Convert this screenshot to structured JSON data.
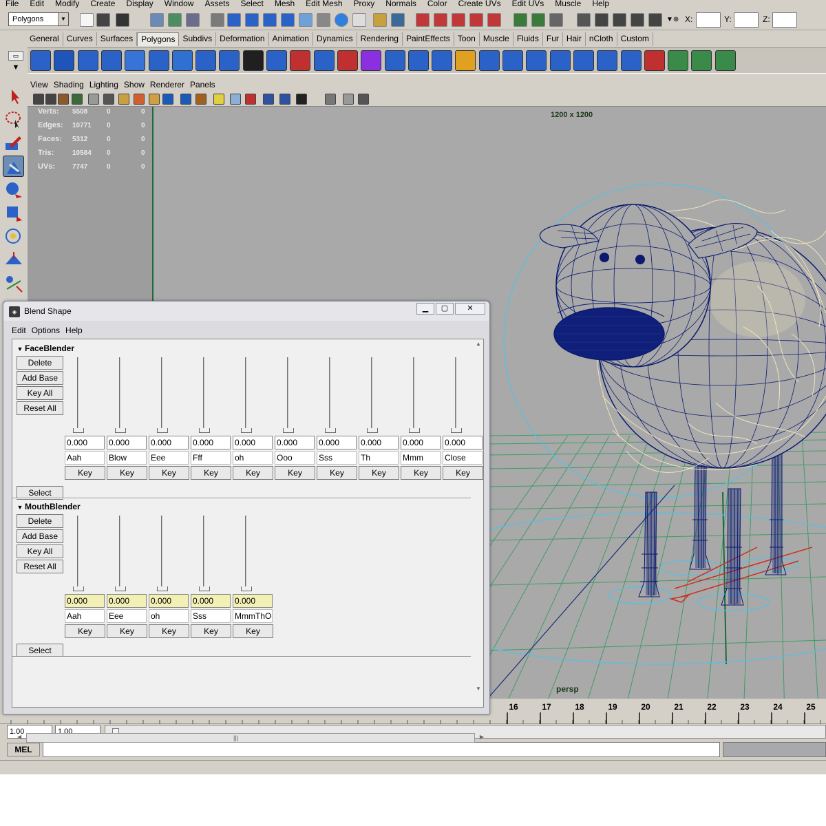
{
  "menubar": [
    "File",
    "Edit",
    "Modify",
    "Create",
    "Display",
    "Window",
    "Assets",
    "Select",
    "Mesh",
    "Edit Mesh",
    "Proxy",
    "Normals",
    "Color",
    "Create UVs",
    "Edit UVs",
    "Muscle",
    "Help"
  ],
  "status_line": {
    "mode": "Polygons",
    "x_label": "X:",
    "y_label": "Y:",
    "z_label": "Z:"
  },
  "shelf_tabs": [
    "General",
    "Curves",
    "Surfaces",
    "Polygons",
    "Subdivs",
    "Deformation",
    "Animation",
    "Dynamics",
    "Rendering",
    "PaintEffects",
    "Toon",
    "Muscle",
    "Fluids",
    "Fur",
    "Hair",
    "nCloth",
    "Custom"
  ],
  "active_shelf_tab": "Polygons",
  "panel_menu": [
    "View",
    "Shading",
    "Lighting",
    "Show",
    "Renderer",
    "Panels"
  ],
  "hud": {
    "rows": [
      {
        "label": "Verts:",
        "v1": "5508",
        "v2": "0",
        "v3": "0"
      },
      {
        "label": "Edges:",
        "v1": "10771",
        "v2": "0",
        "v3": "0"
      },
      {
        "label": "Faces:",
        "v1": "5312",
        "v2": "0",
        "v3": "0"
      },
      {
        "label": "Tris:",
        "v1": "10584",
        "v2": "0",
        "v3": "0"
      },
      {
        "label": "UVs:",
        "v1": "7747",
        "v2": "0",
        "v3": "0"
      }
    ],
    "resolution": "1200 x 1200",
    "camera": "persp"
  },
  "timeline": {
    "ticks": [
      "16",
      "17",
      "18",
      "19",
      "20",
      "21",
      "22",
      "23",
      "24",
      "25"
    ]
  },
  "range": {
    "start": "1.00",
    "end": "1.00"
  },
  "mel": {
    "label": "MEL"
  },
  "blend_shape": {
    "title": "Blend Shape",
    "menu": [
      "Edit",
      "Options",
      "Help"
    ],
    "buttons": {
      "delete": "Delete",
      "add_base": "Add Base",
      "key_all": "Key All",
      "reset_all": "Reset All",
      "select": "Select",
      "key": "Key"
    },
    "face": {
      "name": "FaceBlender",
      "targets": [
        {
          "name": "Aah",
          "value": "0.000"
        },
        {
          "name": "Blow",
          "value": "0.000"
        },
        {
          "name": "Eee",
          "value": "0.000"
        },
        {
          "name": "Fff",
          "value": "0.000"
        },
        {
          "name": "oh",
          "value": "0.000"
        },
        {
          "name": "Ooo",
          "value": "0.000"
        },
        {
          "name": "Sss",
          "value": "0.000"
        },
        {
          "name": "Th",
          "value": "0.000"
        },
        {
          "name": "Mmm",
          "value": "0.000"
        },
        {
          "name": "Close",
          "value": "0.000"
        }
      ]
    },
    "mouth": {
      "name": "MouthBlender",
      "targets": [
        {
          "name": "Aah",
          "value": "0.000"
        },
        {
          "name": "Eee",
          "value": "0.000"
        },
        {
          "name": "oh",
          "value": "0.000"
        },
        {
          "name": "Sss",
          "value": "0.000"
        },
        {
          "name": "MmmThOo",
          "value": "0.000"
        }
      ]
    }
  },
  "colors": {
    "viewport_bg": "#a9a9a9",
    "wire": "#0b1a6e",
    "hair": "#efe3bc",
    "grid": "#2e9a5a",
    "select_circle": "#55c0e8",
    "ui_bg": "#d4d0c8"
  }
}
